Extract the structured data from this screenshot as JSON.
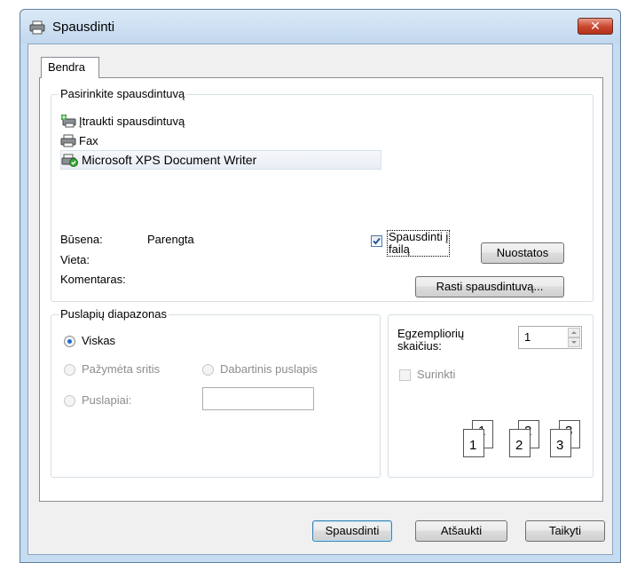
{
  "window": {
    "title": "Spausdinti",
    "close_glyph": "✕"
  },
  "tabs": [
    {
      "label": "Bendra"
    }
  ],
  "printer_group": {
    "label": "Pasirinkite spausdintuvą",
    "printers": [
      {
        "label": "Įtraukti spausdintuvą",
        "icon": "add-printer-icon"
      },
      {
        "label": "Fax",
        "icon": "fax-printer-icon"
      },
      {
        "label": "Microsoft XPS Document Writer",
        "icon": "xps-printer-icon",
        "selected": true
      }
    ],
    "status_label": "Būsena:",
    "status_value": "Parengta",
    "location_label": "Vieta:",
    "comment_label": "Komentaras:",
    "print_to_file_line1": "Spausdinti į",
    "print_to_file_line2": "failą",
    "print_to_file_checked": true,
    "preferences_button": "Nuostatos",
    "find_printer_button": "Rasti spausdintuvą..."
  },
  "page_range": {
    "label": "Puslapių diapazonas",
    "all": "Viskas",
    "selection": "Pažymėta sritis",
    "current_page": "Dabartinis puslapis",
    "pages": "Puslapiai:",
    "pages_value": ""
  },
  "copies": {
    "label_line1": "Egzempliorių",
    "label_line2": "skaičius:",
    "value": "1",
    "collate": "Surinkti",
    "collate_icon_numbers": [
      "1",
      "1",
      "2",
      "2",
      "3",
      "3"
    ]
  },
  "footer": {
    "print_button": "Spausdinti",
    "cancel_button": "Atšaukti",
    "apply_button": "Taikyti"
  },
  "colors": {
    "accent": "#1c6ed0",
    "close": "#c9452c"
  }
}
